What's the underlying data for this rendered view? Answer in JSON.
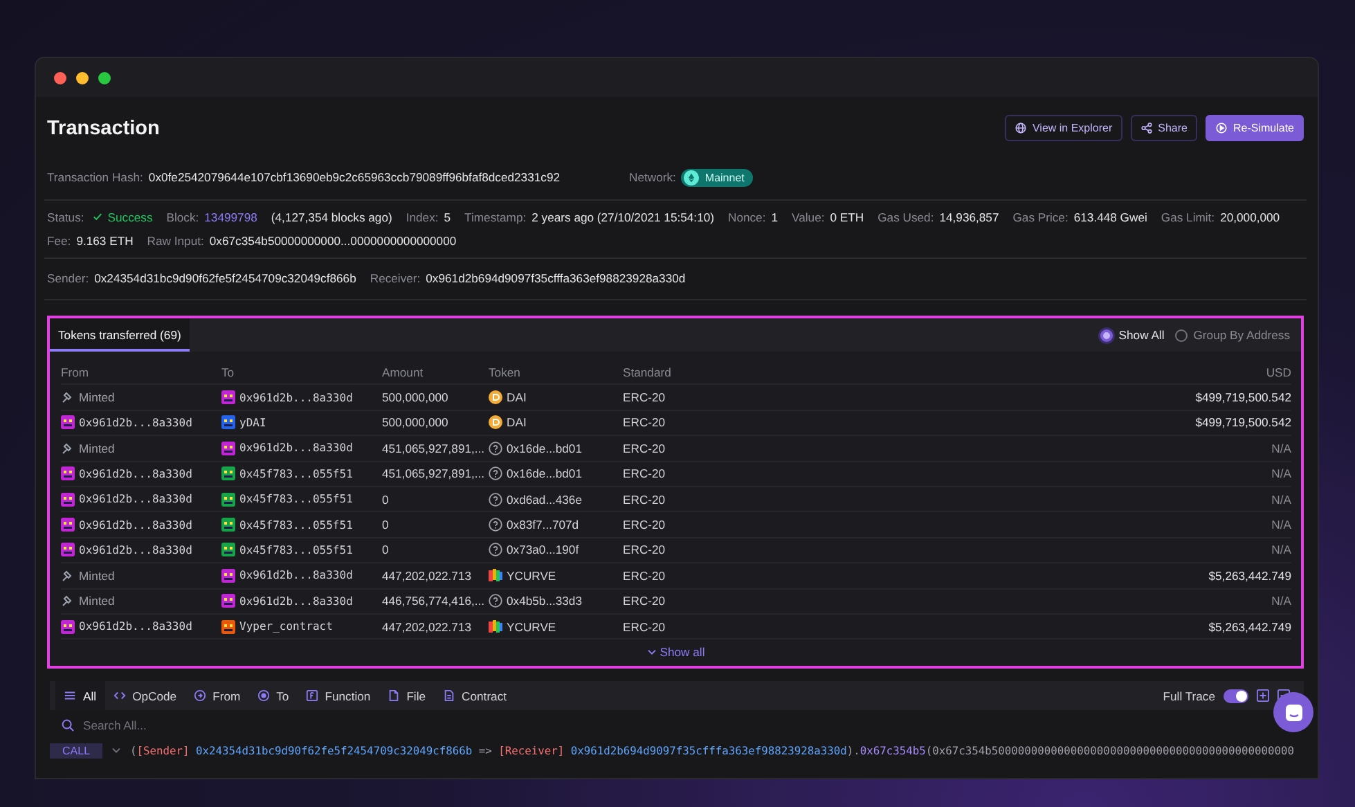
{
  "header": {
    "title": "Transaction",
    "buttons": [
      {
        "label": "View in Explorer",
        "kind": "explorer"
      },
      {
        "label": "Share",
        "kind": "share"
      },
      {
        "label": "Re-Simulate",
        "kind": "resimulate"
      }
    ]
  },
  "hash": {
    "label": "Transaction Hash:",
    "value": "0x0fe2542079644e107cbf13690eb9c2c65963ccb79089ff96bfaf8dced2331c92"
  },
  "network": {
    "label": "Network:",
    "value": "Mainnet"
  },
  "details": [
    {
      "label": "Status:",
      "value": "Success",
      "kind": "status"
    },
    {
      "label": "Block:",
      "value": "13499798",
      "note": "(4,127,354 blocks ago)",
      "kind": "link"
    },
    {
      "label": "Index:",
      "value": "5",
      "kind": "plain"
    },
    {
      "label": "Timestamp:",
      "value": "2 years ago (27/10/2021 15:54:10)",
      "kind": "plain"
    },
    {
      "label": "Nonce:",
      "value": "1",
      "kind": "plain"
    },
    {
      "label": "Value:",
      "value": "0 ETH",
      "kind": "plain"
    },
    {
      "label": "Gas Used:",
      "value": "14,936,857",
      "kind": "plain"
    },
    {
      "label": "Gas Price:",
      "value": "613.448 Gwei",
      "kind": "plain"
    },
    {
      "label": "Gas Limit:",
      "value": "20,000,000",
      "kind": "plain"
    }
  ],
  "details_2": [
    {
      "label": "Fee:",
      "value": "9.163 ETH"
    },
    {
      "label": "Raw Input:",
      "value": "0x67c354b50000000000...0000000000000000"
    }
  ],
  "parties": [
    {
      "label": "Sender:",
      "value": "0x24354d31bc9d90f62fe5f2454709c32049cf866b"
    },
    {
      "label": "Receiver:",
      "value": "0x961d2b694d9097f35cfffa363ef98823928a330d"
    }
  ],
  "tokens": {
    "tab": {
      "label": "Tokens transferred (69)",
      "selected": true
    },
    "view_options": [
      {
        "label": "Show All",
        "selected": true
      },
      {
        "label": "Group By Address",
        "selected": false
      }
    ],
    "columns": [
      "From",
      "To",
      "Amount",
      "Token",
      "Standard",
      "USD"
    ],
    "rows": [
      {
        "from": {
          "kind": "minted",
          "text": "Minted"
        },
        "to": {
          "kind": "address",
          "text": "0x961d2b...8a330d",
          "color": "#c026d3"
        },
        "amount": "500,000,000",
        "token": {
          "kind": "dai",
          "text": "DAI"
        },
        "standard": "ERC-20",
        "usd": "$499,719,500.542",
        "dim": false
      },
      {
        "from": {
          "kind": "address",
          "text": "0x961d2b...8a330d",
          "color": "#c026d3"
        },
        "to": {
          "kind": "address",
          "text": "yDAI",
          "color": "#2563eb"
        },
        "amount": "500,000,000",
        "token": {
          "kind": "dai",
          "text": "DAI"
        },
        "standard": "ERC-20",
        "usd": "$499,719,500.542",
        "dim": false
      },
      {
        "from": {
          "kind": "minted",
          "text": "Minted"
        },
        "to": {
          "kind": "address",
          "text": "0x961d2b...8a330d",
          "color": "#c026d3"
        },
        "amount": "451,065,927,891,...",
        "token": {
          "kind": "unknown",
          "text": "0x16de...bd01"
        },
        "standard": "ERC-20",
        "usd": "N/A",
        "dim": true
      },
      {
        "from": {
          "kind": "address",
          "text": "0x961d2b...8a330d",
          "color": "#c026d3"
        },
        "to": {
          "kind": "address",
          "text": "0x45f783...055f51",
          "color": "#16a34a"
        },
        "amount": "451,065,927,891,...",
        "token": {
          "kind": "unknown",
          "text": "0x16de...bd01"
        },
        "standard": "ERC-20",
        "usd": "N/A",
        "dim": true
      },
      {
        "from": {
          "kind": "address",
          "text": "0x961d2b...8a330d",
          "color": "#c026d3"
        },
        "to": {
          "kind": "address",
          "text": "0x45f783...055f51",
          "color": "#16a34a"
        },
        "amount": "0",
        "token": {
          "kind": "unknown",
          "text": "0xd6ad...436e"
        },
        "standard": "ERC-20",
        "usd": "N/A",
        "dim": true
      },
      {
        "from": {
          "kind": "address",
          "text": "0x961d2b...8a330d",
          "color": "#c026d3"
        },
        "to": {
          "kind": "address",
          "text": "0x45f783...055f51",
          "color": "#16a34a"
        },
        "amount": "0",
        "token": {
          "kind": "unknown",
          "text": "0x83f7...707d"
        },
        "standard": "ERC-20",
        "usd": "N/A",
        "dim": true
      },
      {
        "from": {
          "kind": "address",
          "text": "0x961d2b...8a330d",
          "color": "#c026d3"
        },
        "to": {
          "kind": "address",
          "text": "0x45f783...055f51",
          "color": "#16a34a"
        },
        "amount": "0",
        "token": {
          "kind": "unknown",
          "text": "0x73a0...190f"
        },
        "standard": "ERC-20",
        "usd": "N/A",
        "dim": true
      },
      {
        "from": {
          "kind": "minted",
          "text": "Minted"
        },
        "to": {
          "kind": "address",
          "text": "0x961d2b...8a330d",
          "color": "#c026d3"
        },
        "amount": "447,202,022.713",
        "token": {
          "kind": "ycurve",
          "text": "YCURVE"
        },
        "standard": "ERC-20",
        "usd": "$5,263,442.749",
        "dim": false
      },
      {
        "from": {
          "kind": "minted",
          "text": "Minted"
        },
        "to": {
          "kind": "address",
          "text": "0x961d2b...8a330d",
          "color": "#c026d3"
        },
        "amount": "446,756,774,416,...",
        "token": {
          "kind": "unknown",
          "text": "0x4b5b...33d3"
        },
        "standard": "ERC-20",
        "usd": "N/A",
        "dim": true
      },
      {
        "from": {
          "kind": "address",
          "text": "0x961d2b...8a330d",
          "color": "#c026d3"
        },
        "to": {
          "kind": "address",
          "text": "Vyper_contract",
          "color": "#ea580c"
        },
        "amount": "447,202,022.713",
        "token": {
          "kind": "ycurve",
          "text": "YCURVE"
        },
        "standard": "ERC-20",
        "usd": "$5,263,442.749",
        "dim": false
      }
    ],
    "show_all": "Show all"
  },
  "trace": {
    "tabs": [
      {
        "label": "All",
        "selected": true
      },
      {
        "label": "OpCode",
        "selected": false
      },
      {
        "label": "From",
        "selected": false
      },
      {
        "label": "To",
        "selected": false
      },
      {
        "label": "Function",
        "selected": false
      },
      {
        "label": "File",
        "selected": false
      },
      {
        "label": "Contract",
        "selected": false
      }
    ],
    "full_trace": {
      "label": "Full Trace",
      "on": true
    },
    "search_placeholder": "Search All...",
    "line": {
      "op": "CALL",
      "segments": [
        {
          "text": "(",
          "kind": "punct"
        },
        {
          "text": "[Sender]",
          "kind": "tag"
        },
        {
          "text": " 0x24354d31bc9d90f62fe5f2454709c32049cf866b ",
          "kind": "address"
        },
        {
          "text": "=> ",
          "kind": "punct"
        },
        {
          "text": "[Receiver]",
          "kind": "tag"
        },
        {
          "text": " 0x961d2b694d9097f35cfffa363ef98823928a330d",
          "kind": "address"
        },
        {
          "text": ").",
          "kind": "punct"
        },
        {
          "text": "0x67c354b5",
          "kind": "method"
        },
        {
          "text": "(0x67c354b5000000000000000000000000000000000000000000000",
          "kind": "punct"
        }
      ]
    }
  }
}
